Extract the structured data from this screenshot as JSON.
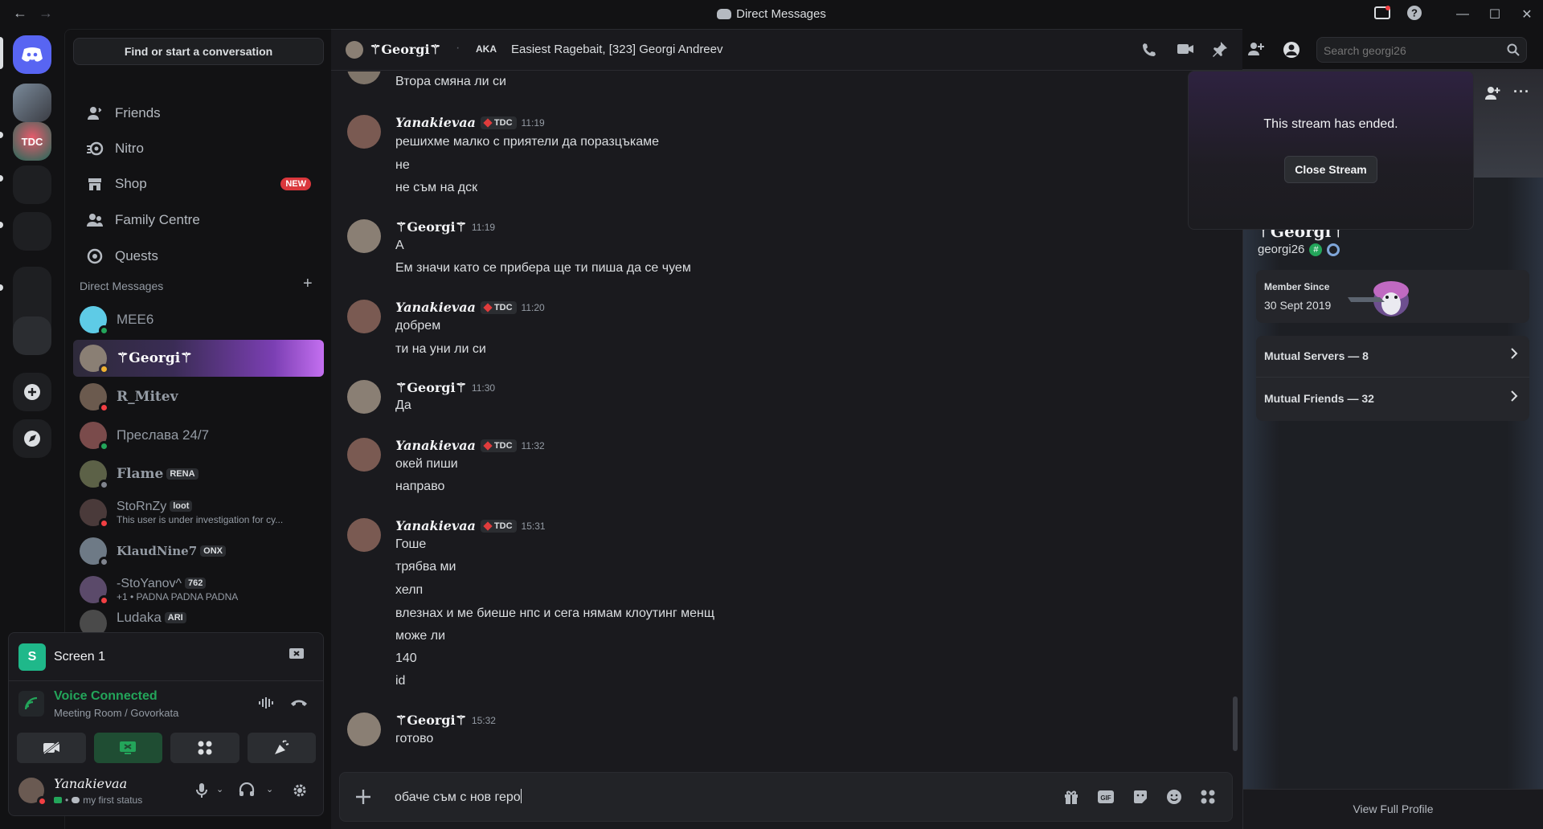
{
  "window": {
    "title": "Direct Messages",
    "back": "←",
    "forward": "→"
  },
  "sidebar": {
    "find_button": "Find or start a conversation",
    "nav": [
      {
        "label": "Friends",
        "icon": "friends-icon"
      },
      {
        "label": "Nitro",
        "icon": "nitro-icon"
      },
      {
        "label": "Shop",
        "icon": "shop-icon",
        "badge": "NEW"
      },
      {
        "label": "Family Centre",
        "icon": "family-icon"
      },
      {
        "label": "Quests",
        "icon": "quests-icon"
      }
    ],
    "dm_header": "Direct Messages",
    "dm_plus": "+",
    "dms": [
      {
        "name": "MEE6",
        "sub": "",
        "tag": "",
        "status": "online",
        "color": "#5ecbe6"
      },
      {
        "name": "⚚Georgi⚚",
        "sub": "",
        "tag": "",
        "status": "idle",
        "color": "#8a7f74"
      },
      {
        "name": "R_Mitev",
        "sub": "",
        "tag": "",
        "status": "dnd",
        "color": "#6b5a4e"
      },
      {
        "name": "Преслава 24/7",
        "sub": "",
        "tag": "",
        "status": "online",
        "color": "#7a4b4b"
      },
      {
        "name": "Flame",
        "sub": "",
        "tag": "RENA",
        "status": "offline",
        "color": "#5c6147"
      },
      {
        "name": "StoRnZy",
        "sub": "This user is under investigation for cy...",
        "tag": "loot",
        "status": "dnd",
        "color": "#4a3a3a"
      },
      {
        "name": "KlaudNine7",
        "sub": "",
        "tag": "ONX",
        "status": "offline",
        "color": "#6e7a86"
      },
      {
        "name": "-StoYanov^",
        "sub": "+1 • PADNA PADNA PADNA",
        "tag": "762",
        "status": "dnd",
        "color": "#5b4a6a"
      },
      {
        "name": "Ludaka",
        "sub": "",
        "tag": "ARI",
        "status": "offline",
        "color": "#4a4a4a"
      }
    ]
  },
  "voice": {
    "screen_title": "Screen 1",
    "connected": "Voice Connected",
    "location": "Meeting Room / Govorkata",
    "user_name": "Yanakievaa",
    "user_status": "my first status"
  },
  "chat": {
    "header_name": "⚚Georgi⚚",
    "aka_label": "AKA",
    "aka_value": "Easiest Ragebait, [323] Georgi Andreev",
    "search_placeholder": "Search georgi26",
    "messages": [
      {
        "author": "",
        "time": "",
        "lines": [
          "Втора смяна ли си"
        ]
      },
      {
        "author": "Yanakievaa",
        "badge": "TDC",
        "time": "11:19",
        "lines": [
          "решихме малко с приятели да поразцъкаме",
          "не",
          "не съм на дск"
        ]
      },
      {
        "author": "⚚Georgi⚚",
        "badge": "",
        "time": "11:19",
        "lines": [
          "А",
          "Ем значи като се прибера ще ти пиша да се чуем"
        ]
      },
      {
        "author": "Yanakievaa",
        "badge": "TDC",
        "time": "11:20",
        "lines": [
          "добрем",
          "ти на уни ли си"
        ]
      },
      {
        "author": "⚚Georgi⚚",
        "badge": "",
        "time": "11:30",
        "lines": [
          "Да"
        ]
      },
      {
        "author": "Yanakievaa",
        "badge": "TDC",
        "time": "11:32",
        "lines": [
          "окей пиши",
          "направо"
        ]
      },
      {
        "author": "Yanakievaa",
        "badge": "TDC",
        "time": "15:31",
        "lines": [
          "Гоше",
          "трябва ми",
          "хелп",
          "влезнах и ме биеше нпс и сега нямам клоутинг менщ",
          "може ли",
          "140",
          "id"
        ]
      },
      {
        "author": "⚚Georgi⚚",
        "badge": "",
        "time": "15:32",
        "lines": [
          "готово"
        ]
      }
    ],
    "composer_value": "обаче съм с нов геро"
  },
  "stream_popup": {
    "text": "This stream has ended.",
    "button": "Close Stream"
  },
  "profile": {
    "display_name": "⚚Georgi⚚",
    "username": "georgi26",
    "member_since_label": "Member Since",
    "member_since": "30 Sept 2019",
    "mutual_servers": "Mutual Servers — 8",
    "mutual_friends": "Mutual Friends — 32",
    "view_full": "View Full Profile"
  },
  "colors": {
    "accent": "#5865f2",
    "online": "#23a55a",
    "idle": "#f0b232",
    "dnd": "#f23f43",
    "offline": "#80848e",
    "voice_green": "#23a55a"
  }
}
